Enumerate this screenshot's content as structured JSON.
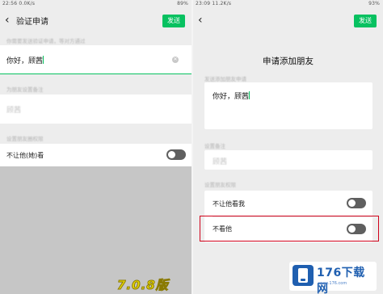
{
  "left_screen": {
    "status_bar": {
      "left_text": "22:56 0.0K/s",
      "right_text": "89%"
    },
    "nav": {
      "title": "验证申请",
      "send_label": "发送"
    },
    "section_label_1": "你需要发送验证申请，等对方通过",
    "message_value": "你好，顾茜",
    "section_label_2": "为朋友设置备注",
    "remark_value": "顾茜",
    "section_label_3": "设置朋友圈权限",
    "row_label": "不让他(她)看",
    "row_toggle_on": false
  },
  "right_screen": {
    "status_bar": {
      "left_text": "23:09 11.2K/s",
      "right_text": "93%"
    },
    "nav": {
      "send_label": "发送"
    },
    "sheet_title": "申请添加朋友",
    "section_label_1": "发送添加朋友申请",
    "message_value": "你好，顾茜",
    "section_label_2": "设置备注",
    "remark_value": "顾茜",
    "section_label_3": "设置朋友权限",
    "row_1_label": "不让他看我",
    "row_1_toggle_on": false,
    "row_2_label": "不看他",
    "row_2_toggle_on": false
  },
  "overlay": {
    "version_text": "7.0.8版",
    "watermark_text": "176下载网",
    "watermark_sub": "www.176.com"
  },
  "colors": {
    "accent_green": "#07c160",
    "highlight_red": "#d0021b",
    "toggle_off": "#5f5f5f"
  }
}
